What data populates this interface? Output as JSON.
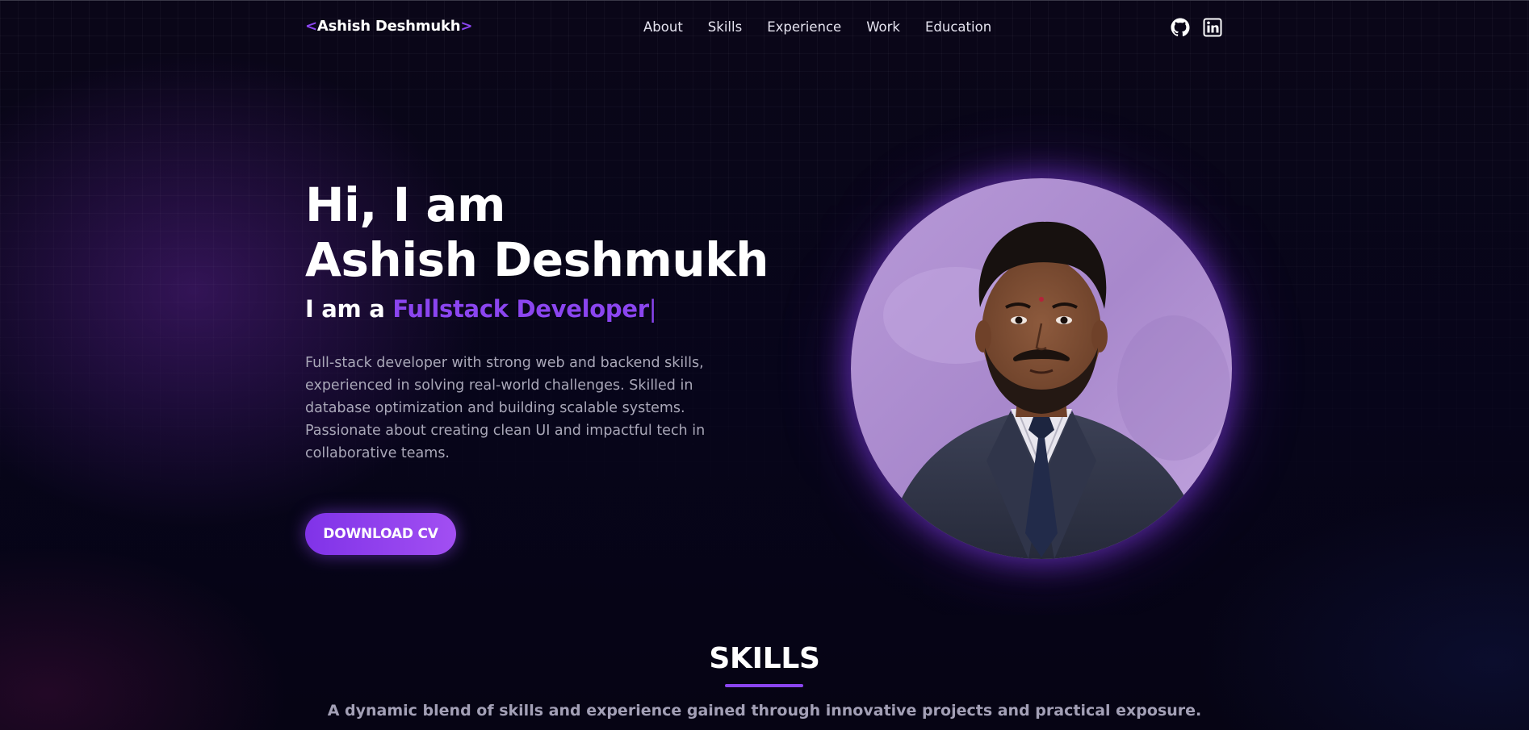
{
  "nav": {
    "logo_open": "<",
    "logo_name": "Ashish Deshmukh",
    "logo_close": ">",
    "links": [
      "About",
      "Skills",
      "Experience",
      "Work",
      "Education"
    ],
    "icons": [
      "github-icon",
      "linkedin-icon"
    ]
  },
  "hero": {
    "greeting_line1": "Hi, I am",
    "greeting_line2": "Ashish Deshmukh",
    "role_prefix": "I am a ",
    "role": "Fullstack Developer",
    "cursor": "|",
    "bio": "Full-stack developer with strong web and backend skills, experienced in solving real-world challenges. Skilled in database optimization and building scalable systems. Passionate about creating clean UI and impactful tech in collaborative teams.",
    "cv_button": "DOWNLOAD CV"
  },
  "skills": {
    "title": "SKILLS",
    "subtitle": "A dynamic blend of skills and experience gained through innovative projects and practical exposure."
  },
  "colors": {
    "accent": "#8b45f0",
    "background": "#060414",
    "muted_text": "#a9a7b8"
  }
}
